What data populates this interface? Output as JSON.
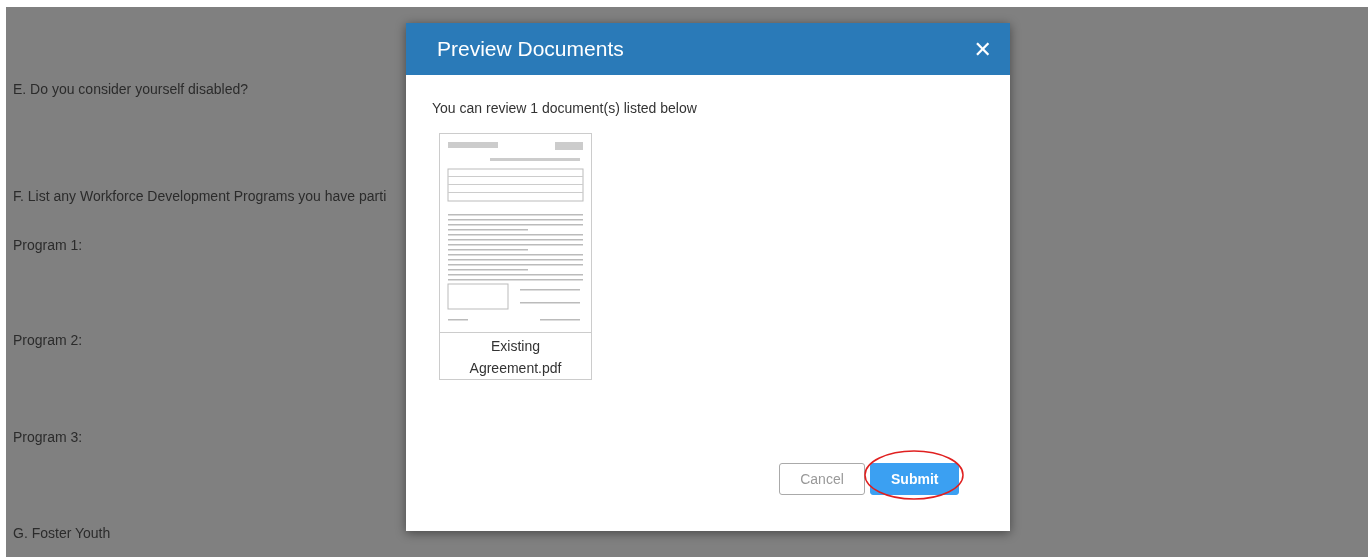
{
  "form": {
    "items": [
      "E. Do you consider yourself disabled?",
      "F. List any Workforce Development Programs you have parti",
      "Program 1:",
      "Program 2:",
      "Program 3:",
      "G. Foster Youth"
    ]
  },
  "dialog": {
    "title": "Preview Documents",
    "close": "✕",
    "message": "You can review 1 document(s) listed below",
    "documents": [
      {
        "name": "Existing Agreement.pdf"
      }
    ],
    "buttons": [
      {
        "label": "Cancel",
        "kind": "secondary",
        "highlighted": false
      },
      {
        "label": "Submit",
        "kind": "primary",
        "highlighted": true
      }
    ]
  }
}
